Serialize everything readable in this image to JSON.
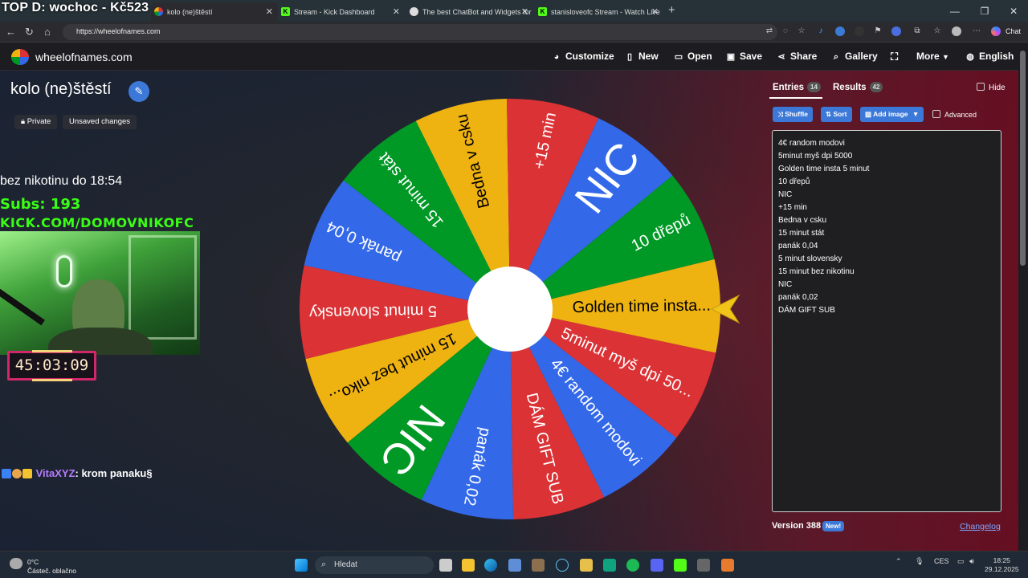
{
  "browser": {
    "overlay_text": "TOP D: wochoc - Kč523",
    "tabs": [
      {
        "label": "kolo (ne)štěstí",
        "active": true
      },
      {
        "label": "Stream - Kick Dashboard"
      },
      {
        "label": "The best ChatBot and Widgets for"
      },
      {
        "label": "stanisloveofc Stream - Watch Live"
      }
    ],
    "url": "https://wheelofnames.com",
    "chat_label": "Chat"
  },
  "site": {
    "name": "wheelofnames.com",
    "nav": [
      "Customize",
      "New",
      "Open",
      "Save",
      "Share",
      "Gallery",
      "More",
      "English"
    ]
  },
  "wheel": {
    "title": "kolo (ne)štěstí",
    "chips": [
      "Private",
      "Unsaved changes"
    ],
    "segments": [
      {
        "label": "Golden time insta...",
        "color": "#eeb211"
      },
      {
        "label": "5minut myš dpi 50...",
        "color": "#db3236"
      },
      {
        "label": "4€ random modovi",
        "color": "#3369e8"
      },
      {
        "label": "DÁM GIFT SUB",
        "color": "#db3236"
      },
      {
        "label": "panák 0,02",
        "color": "#3369e8"
      },
      {
        "label": "NIC",
        "color": "#009925"
      },
      {
        "label": "15 minut bez niko...",
        "color": "#eeb211"
      },
      {
        "label": "5 minut slovensky",
        "color": "#db3236"
      },
      {
        "label": "panák 0,04",
        "color": "#3369e8"
      },
      {
        "label": "15 minut stát",
        "color": "#009925"
      },
      {
        "label": "Bedna v csku",
        "color": "#eeb211"
      },
      {
        "label": "+15 min",
        "color": "#db3236"
      },
      {
        "label": "NIC",
        "color": "#3369e8"
      },
      {
        "label": "10 dřepů",
        "color": "#009925"
      }
    ]
  },
  "stream_overlay": {
    "note": "bez nikotinu do 18:54",
    "subs": "Subs: 193",
    "channel": "KICK.COM/DOMOVNIKOFC",
    "timer": "45:03:09",
    "chat_user": "VitaXYZ",
    "chat_message": ": krom panaku§"
  },
  "panel": {
    "entries_tab": "Entries",
    "entries_count": "14",
    "results_tab": "Results",
    "results_count": "42",
    "hide_label": "Hide",
    "buttons": [
      "Shuffle",
      "Sort",
      "Add image"
    ],
    "advanced_label": "Advanced",
    "entries": [
      "4€ random modovi",
      "5minut myš dpi 5000",
      "Golden time insta 5 minut",
      "10 dřepů",
      "NIC",
      "+15 min",
      "Bedna v csku",
      "15 minut stát",
      "panák 0,04",
      "5 minut slovensky",
      "15 minut bez nikotinu",
      "NIC",
      "panák 0,02",
      "DÁM GIFT SUB"
    ],
    "version": "Version 388",
    "new_badge": "New!",
    "changelog": "Changelog"
  },
  "taskbar": {
    "weather_temp": "0°C",
    "weather_desc": "Částeč. oblačno",
    "search_placeholder": "Hledat",
    "language": "CES",
    "time": "18:25",
    "date": "29.12.2025"
  }
}
